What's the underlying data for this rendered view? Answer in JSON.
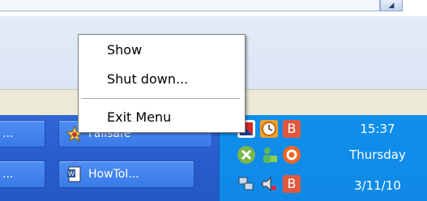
{
  "context_menu": {
    "items": [
      {
        "label": "Show"
      },
      {
        "label": "Shut down..."
      },
      {
        "label": "Exit Menu"
      }
    ]
  },
  "taskbar": {
    "buttons": [
      {
        "label": "...",
        "row": 1
      },
      {
        "label": "Failsafe",
        "icon": "failsafe-star-icon"
      },
      {
        "label": "...",
        "row": 2
      },
      {
        "label": "HowToI...",
        "icon": "word-document-icon"
      }
    ]
  },
  "tray": {
    "icons": [
      "flag-icon",
      "clock-icon",
      "b-app-icon",
      "xbox-icon",
      "user-status-icon",
      "avast-icon",
      "network-icon",
      "volume-icon",
      "b-app-icon"
    ],
    "clock": {
      "time": "15:37",
      "day": "Thursday",
      "date": "3/11/10"
    }
  },
  "colors": {
    "taskbar": "#2a5ccc",
    "tray": "#1089e6",
    "menu_background": "#ffffff"
  }
}
